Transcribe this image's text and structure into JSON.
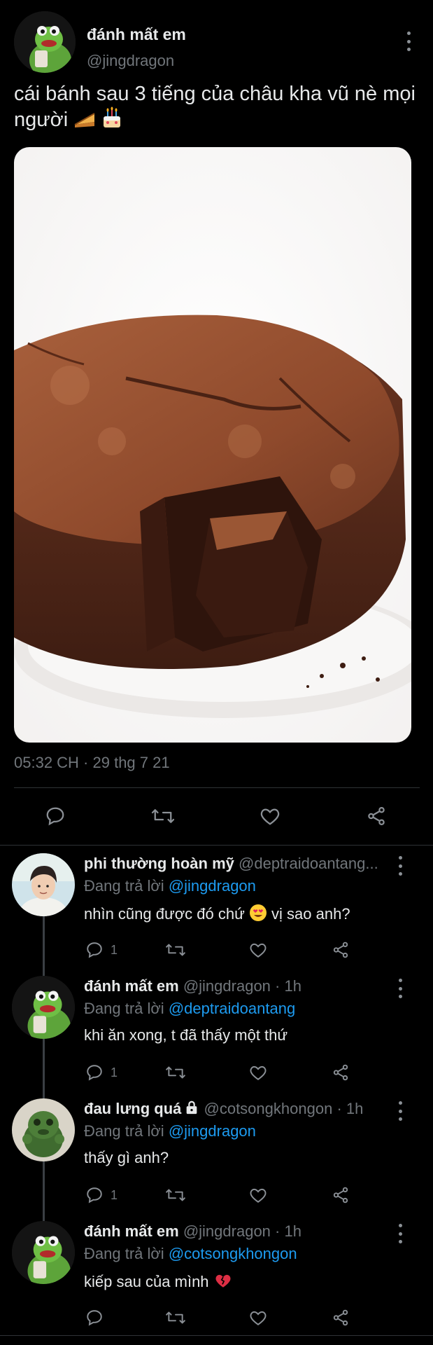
{
  "main_tweet": {
    "author_name": "đánh mất em",
    "author_handle": "@jingdragon",
    "text": "cái bánh sau 3 tiếng của châu kha vũ nè mọi người",
    "text_emojis": [
      "pie-emoji",
      "birthday-cake-emoji"
    ],
    "timestamp": "05:32 CH · 29 thg 7 21"
  },
  "replies": [
    {
      "name": "phi thường hoàn mỹ",
      "handle": "@deptraidoantang...",
      "time": "",
      "locked": false,
      "replying_prefix": "Đang trả lời ",
      "replying_to": "@jingdragon",
      "text": "nhìn cũng được đó chứ",
      "text_after_emoji": "vị sao anh?",
      "emoji": "heart-eyes-emoji",
      "reply_count": "1",
      "avatar": "person-photo"
    },
    {
      "name": "đánh mất em",
      "handle": "@jingdragon",
      "time": "· 1h",
      "locked": false,
      "replying_prefix": "Đang trả lời ",
      "replying_to": "@deptraidoantang",
      "text": "khi ăn xong, t đã thấy một thứ",
      "reply_count": "1",
      "avatar": "frog-avatar"
    },
    {
      "name": "đau lưng quá",
      "handle": "@cotsongkhongon",
      "time": "· 1h",
      "locked": true,
      "replying_prefix": "Đang trả lời ",
      "replying_to": "@jingdragon",
      "text": "thấy gì anh?",
      "reply_count": "1",
      "avatar": "green-creature-avatar"
    },
    {
      "name": "đánh mất em",
      "handle": "@jingdragon",
      "time": "· 1h",
      "locked": false,
      "replying_prefix": "Đang trả lời ",
      "replying_to": "@cotsongkhongon",
      "text": "kiếp sau của mình",
      "emoji": "broken-heart-emoji",
      "reply_count": "",
      "avatar": "frog-avatar"
    }
  ],
  "colors": {
    "background": "#000000",
    "text": "#e7e9ea",
    "secondary": "#71767b",
    "mention": "#1d9bf0",
    "divider": "#2f3336"
  },
  "icons": [
    "reply-icon",
    "retweet-icon",
    "like-icon",
    "share-icon",
    "more-icon"
  ]
}
